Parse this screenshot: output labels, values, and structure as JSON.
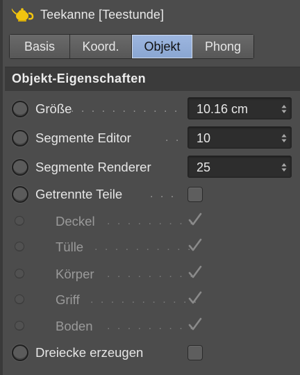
{
  "header": {
    "title": "Teekanne [Teestunde]",
    "icon": "teapot-icon",
    "icon_color": "#f0c000"
  },
  "tabs": [
    {
      "label": "Basis",
      "active": false
    },
    {
      "label": "Koord.",
      "active": false
    },
    {
      "label": "Objekt",
      "active": true
    },
    {
      "label": "Phong",
      "active": false
    }
  ],
  "section": {
    "title": "Objekt-Eigenschaften"
  },
  "rows": {
    "groesse": {
      "label": "Größe",
      "dots": ". . . . . . . . . . .",
      "value": "10.16 cm"
    },
    "seg_editor": {
      "label": "Segmente Editor",
      "dots": ". .",
      "value": "10"
    },
    "seg_renderer": {
      "label": "Segmente Renderer",
      "value": "25"
    },
    "getrennte": {
      "label": "Getrennte Teile",
      "dots": ". . .",
      "checked": false
    },
    "deckel": {
      "label": "Deckel",
      "dots": ". . . . . . . . .",
      "checked": true
    },
    "tuelle": {
      "label": "Tülle",
      "dots": ". . . . . . . . . .",
      "checked": true
    },
    "koerper": {
      "label": "Körper",
      "dots": ". . . . . . . . .",
      "checked": true
    },
    "griff": {
      "label": "Griff",
      "dots": ". . . . . . . . . . .",
      "checked": true
    },
    "boden": {
      "label": "Boden",
      "dots": ". . . . . . . . .",
      "checked": true
    },
    "dreiecke": {
      "label": "Dreiecke erzeugen",
      "checked": false
    }
  },
  "colors": {
    "background": "#4c4c4c",
    "active_tab": "#8aa6d2",
    "field_bg": "#2d2d2d"
  }
}
